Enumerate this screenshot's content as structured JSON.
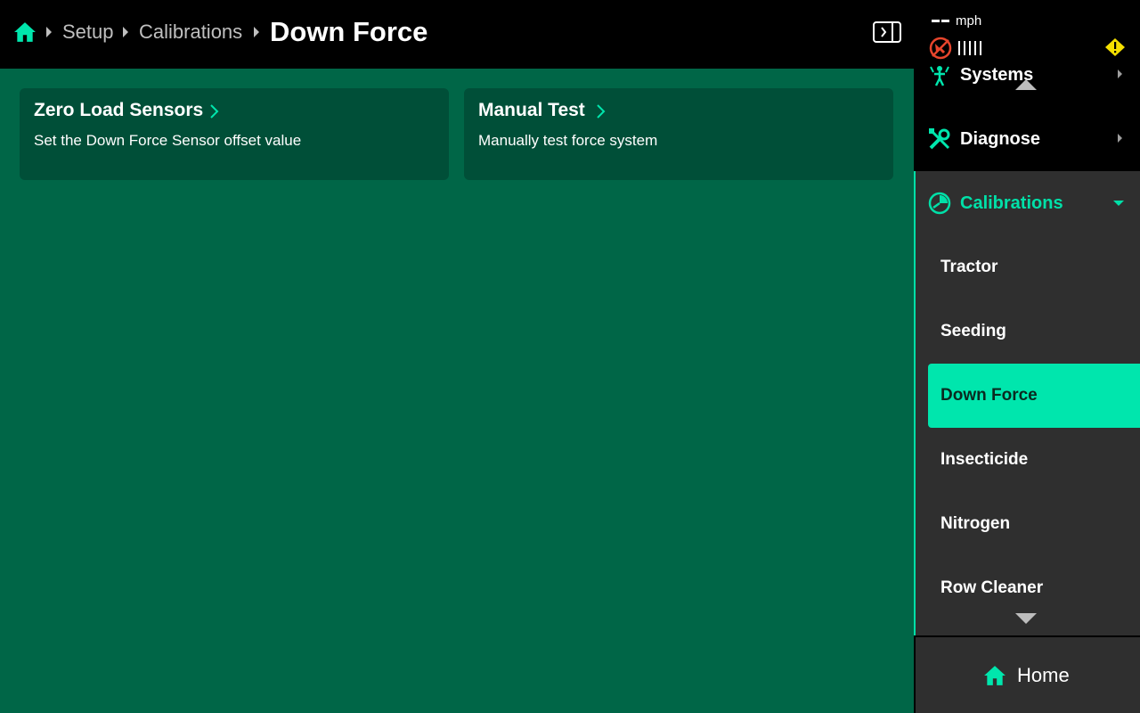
{
  "breadcrumb": {
    "items": [
      "Setup",
      "Calibrations"
    ],
    "current": "Down Force"
  },
  "cards": [
    {
      "title": "Zero Load Sensors",
      "description": "Set the Down Force Sensor offset value"
    },
    {
      "title": "Manual Test",
      "description": "Manually test force system"
    }
  ],
  "status": {
    "speed_unit": "mph"
  },
  "sidebar": {
    "items": [
      {
        "label": "Systems",
        "icon": "systems-icon"
      },
      {
        "label": "Diagnose",
        "icon": "wrench-icon"
      }
    ],
    "calibrations": {
      "label": "Calibrations",
      "icon": "gauge-icon",
      "sub_items": [
        "Tractor",
        "Seeding",
        "Down Force",
        "Insecticide",
        "Nitrogen",
        "Row Cleaner"
      ],
      "active": "Down Force"
    }
  },
  "home_button": {
    "label": "Home"
  },
  "colors": {
    "accent": "#00e6ad",
    "main_bg": "#006647",
    "card_bg": "#004f38",
    "warning": "#f5e000",
    "alert": "#e8452c"
  }
}
